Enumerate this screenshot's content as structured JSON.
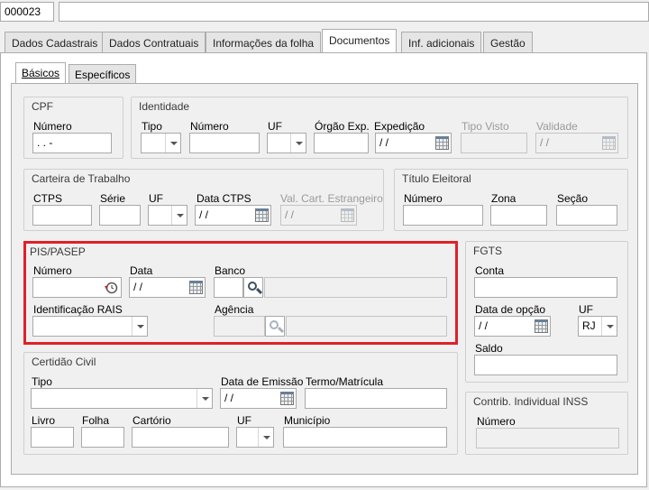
{
  "top": {
    "code_value": "000023",
    "name_value": ""
  },
  "main_tabs": [
    {
      "label": "Dados Cadastrais"
    },
    {
      "label": "Dados Contratuais"
    },
    {
      "label": "Informações da folha"
    },
    {
      "label": "Documentos"
    },
    {
      "label": "Inf. adicionais"
    },
    {
      "label": "Gestão"
    }
  ],
  "sub_tabs": [
    {
      "label": "Básicos"
    },
    {
      "label": "Específicos"
    }
  ],
  "cpf": {
    "title": "CPF",
    "numero_label": "Número",
    "numero_value": " .  .  -"
  },
  "identidade": {
    "title": "Identidade",
    "tipo_label": "Tipo",
    "numero_label": "Número",
    "uf_label": "UF",
    "orgao_label": "Órgão Exp.",
    "expedicao_label": "Expedição",
    "expedicao_value": " / /",
    "tipo_visto_label": "Tipo Visto",
    "validade_label": "Validade",
    "validade_value": " / /"
  },
  "ctps": {
    "title": "Carteira de Trabalho",
    "ctps_label": "CTPS",
    "serie_label": "Série",
    "uf_label": "UF",
    "data_label": "Data CTPS",
    "data_value": " / /",
    "val_label": "Val. Cart. Estrangeiro",
    "val_value": " / /"
  },
  "titulo": {
    "title": "Título Eleitoral",
    "numero_label": "Número",
    "zona_label": "Zona",
    "secao_label": "Seção"
  },
  "pis": {
    "title": "PIS/PASEP",
    "numero_label": "Número",
    "data_label": "Data",
    "data_value": " / /",
    "banco_label": "Banco",
    "rais_label": "Identificação RAIS",
    "agencia_label": "Agência"
  },
  "fgts": {
    "title": "FGTS",
    "conta_label": "Conta",
    "data_opcao_label": "Data de opção",
    "data_opcao_value": " / /",
    "uf_label": "UF",
    "uf_value": "RJ",
    "saldo_label": "Saldo"
  },
  "certidao": {
    "title": "Certidão Civil",
    "tipo_label": "Tipo",
    "data_emissao_label": "Data de Emissão",
    "data_emissao_value": " / /",
    "termo_label": "Termo/Matrícula",
    "livro_label": "Livro",
    "folha_label": "Folha",
    "cartorio_label": "Cartório",
    "uf_label": "UF",
    "municipio_label": "Município"
  },
  "inss": {
    "title": "Contrib. Individual INSS",
    "numero_label": "Número"
  },
  "colors": {
    "highlight": "#e0202a"
  }
}
